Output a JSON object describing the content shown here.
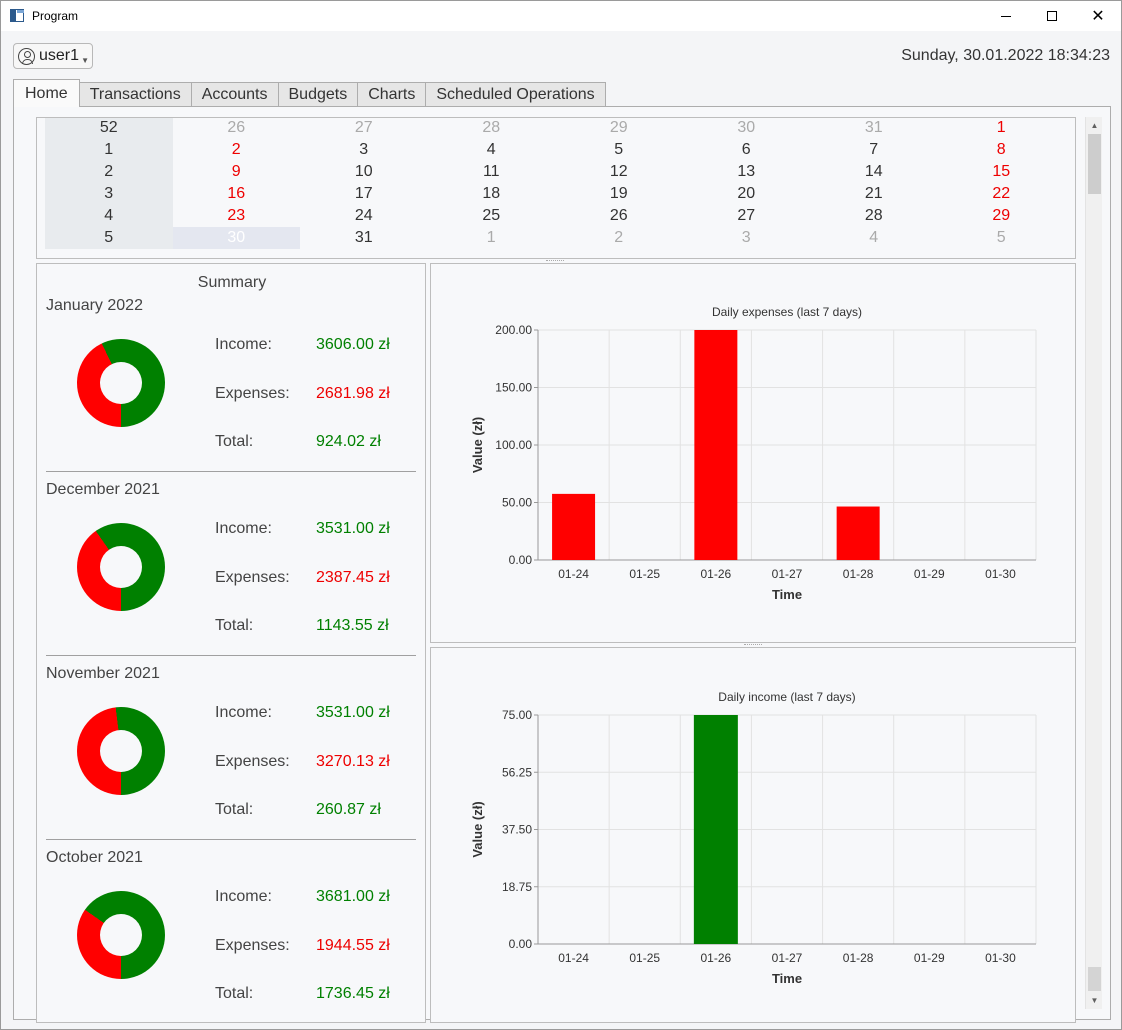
{
  "window": {
    "title": "Program"
  },
  "header": {
    "user": "user1",
    "datetime": "Sunday, 30.01.2022 18:34:23"
  },
  "tabs": [
    {
      "label": "Home",
      "active": true
    },
    {
      "label": "Transactions"
    },
    {
      "label": "Accounts"
    },
    {
      "label": "Budgets"
    },
    {
      "label": "Charts"
    },
    {
      "label": "Scheduled Operations"
    }
  ],
  "calendar": {
    "rows": [
      [
        "52",
        "26",
        "27",
        "28",
        "29",
        "30",
        "31",
        "1"
      ],
      [
        "1",
        "2",
        "3",
        "4",
        "5",
        "6",
        "7",
        "8"
      ],
      [
        "2",
        "9",
        "10",
        "11",
        "12",
        "13",
        "14",
        "15"
      ],
      [
        "3",
        "16",
        "17",
        "18",
        "19",
        "20",
        "21",
        "22"
      ],
      [
        "4",
        "23",
        "24",
        "25",
        "26",
        "27",
        "28",
        "29"
      ],
      [
        "5",
        "30",
        "31",
        "1",
        "2",
        "3",
        "4",
        "5"
      ]
    ]
  },
  "summary": {
    "title": "Summary",
    "labels": {
      "income": "Income:",
      "expenses": "Expenses:",
      "total": "Total:"
    },
    "months": [
      {
        "name": "January 2022",
        "income": "3606.00 zł",
        "expenses": "2681.98 zł",
        "total": "924.02 zł",
        "expense_share": 0.427
      },
      {
        "name": "December 2021",
        "income": "3531.00 zł",
        "expenses": "2387.45 zł",
        "total": "1143.55 zł",
        "expense_share": 0.403
      },
      {
        "name": "November 2021",
        "income": "3531.00 zł",
        "expenses": "3270.13 zł",
        "total": "260.87 zł",
        "expense_share": 0.481
      },
      {
        "name": "October 2021",
        "income": "3681.00 zł",
        "expenses": "1944.55 zł",
        "total": "1736.45 zł",
        "expense_share": 0.346
      }
    ]
  },
  "colors": {
    "income": "#008000",
    "expenses": "#ff0000"
  },
  "chart_data": [
    {
      "type": "bar",
      "title": "Daily expenses (last 7 days)",
      "xlabel": "Time",
      "ylabel": "Value (zł)",
      "categories": [
        "01-24",
        "01-25",
        "01-26",
        "01-27",
        "01-28",
        "01-29",
        "01-30"
      ],
      "values": [
        57.5,
        0,
        200,
        0,
        46.5,
        0,
        0
      ],
      "ylim": [
        0,
        200
      ],
      "yticks": [
        "0.00",
        "50.00",
        "100.00",
        "150.00",
        "200.00"
      ],
      "color": "#ff0000",
      "grid": true
    },
    {
      "type": "bar",
      "title": "Daily income (last 7 days)",
      "xlabel": "Time",
      "ylabel": "Value (zł)",
      "categories": [
        "01-24",
        "01-25",
        "01-26",
        "01-27",
        "01-28",
        "01-29",
        "01-30"
      ],
      "values": [
        0,
        0,
        75,
        0,
        0,
        0,
        0
      ],
      "ylim": [
        0,
        75
      ],
      "yticks": [
        "0.00",
        "18.75",
        "37.50",
        "56.25",
        "75.00"
      ],
      "color": "#008000",
      "grid": true
    }
  ]
}
